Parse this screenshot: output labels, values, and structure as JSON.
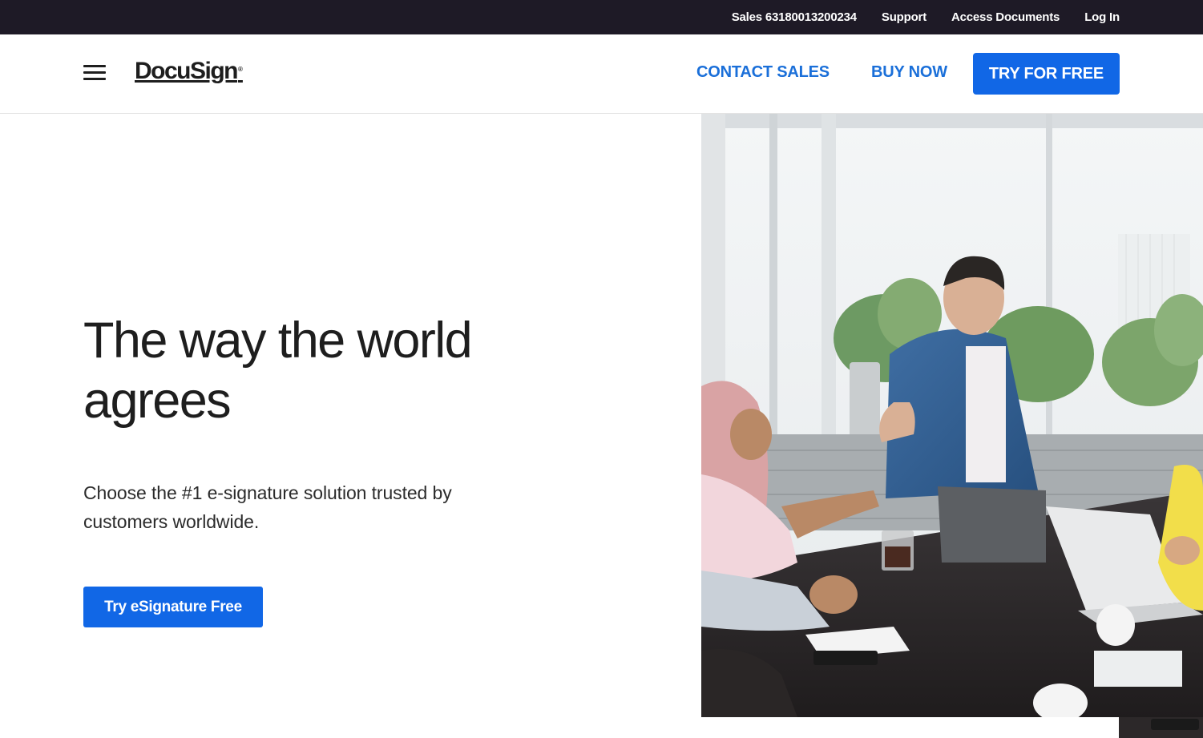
{
  "topbar": {
    "sales": "Sales 63180013200234",
    "support": "Support",
    "access_documents": "Access Documents",
    "log_in": "Log In"
  },
  "header": {
    "logo": "DocuSign",
    "logo_mark": "®",
    "contact_sales": "CONTACT SALES",
    "buy_now": "BUY NOW",
    "try_for_free": "TRY FOR FREE"
  },
  "hero": {
    "title_line1": "The way the world",
    "title_line2": "agrees",
    "subtitle_line1": "Choose the #1 e-signature solution trusted by",
    "subtitle_line2": "customers worldwide.",
    "cta": "Try eSignature Free"
  },
  "colors": {
    "topbar_bg": "#1e1a26",
    "brand_blue": "#1167e6",
    "link_blue": "#1a6fd9"
  },
  "icons": {
    "menu": "hamburger-menu-icon"
  }
}
